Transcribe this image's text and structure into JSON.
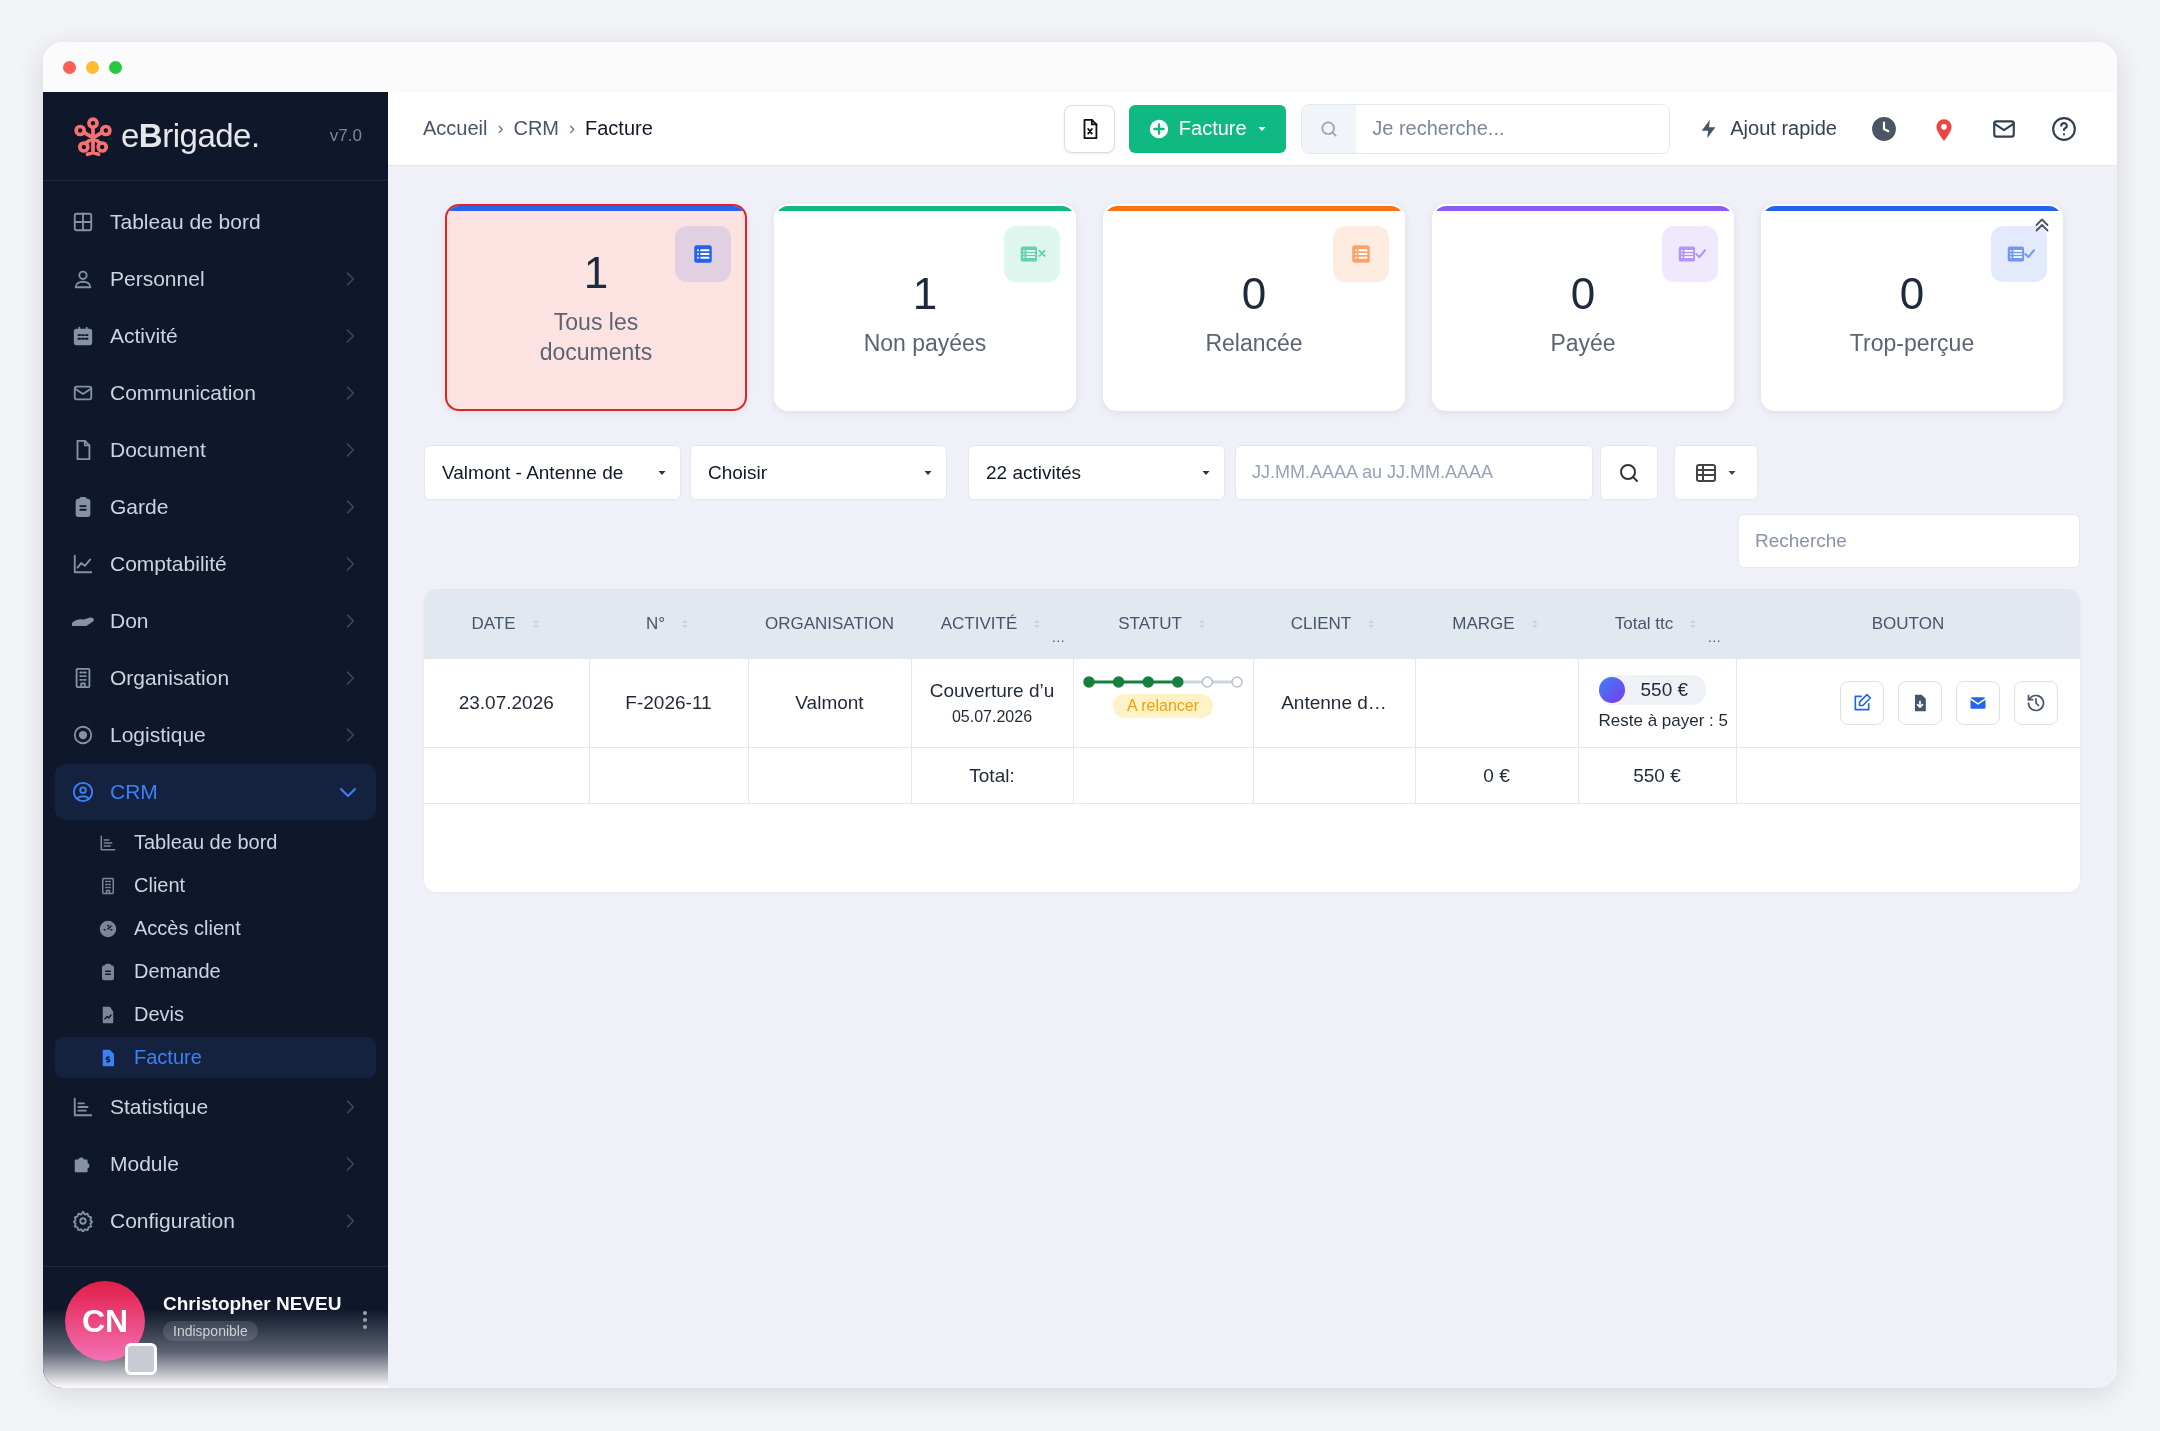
{
  "sidebar": {
    "logo": "e**B**rigade.",
    "version": "v7.0",
    "items": [
      {
        "label": "Tableau de bord",
        "kind": "link",
        "selected": false
      },
      {
        "label": "Personnel",
        "kind": "group",
        "expanded": false,
        "selected": false
      },
      {
        "label": "Activité",
        "kind": "group",
        "expanded": false,
        "selected": false
      },
      {
        "label": "Communication",
        "kind": "group",
        "expanded": false,
        "selected": false
      },
      {
        "label": "Document",
        "kind": "group",
        "expanded": false,
        "selected": false
      },
      {
        "label": "Garde",
        "kind": "group",
        "expanded": false,
        "selected": false
      },
      {
        "label": "Comptabilité",
        "kind": "group",
        "expanded": false,
        "selected": false
      },
      {
        "label": "Don",
        "kind": "group",
        "expanded": false,
        "selected": false
      },
      {
        "label": "Organisation",
        "kind": "group",
        "expanded": false,
        "selected": false
      },
      {
        "label": "Logistique",
        "kind": "group",
        "expanded": false,
        "selected": false
      },
      {
        "label": "CRM",
        "kind": "group",
        "expanded": true,
        "selected": true,
        "children": [
          {
            "label": "Tableau de bord",
            "selected": false
          },
          {
            "label": "Client",
            "selected": false
          },
          {
            "label": "Accès client",
            "selected": false
          },
          {
            "label": "Demande",
            "selected": false
          },
          {
            "label": "Devis",
            "selected": false
          },
          {
            "label": "Facture",
            "selected": true
          }
        ]
      },
      {
        "label": "Statistique",
        "kind": "group",
        "expanded": false,
        "selected": false
      },
      {
        "label": "Module",
        "kind": "group",
        "expanded": false,
        "selected": false
      },
      {
        "label": "Configuration",
        "kind": "group",
        "expanded": false,
        "selected": false
      }
    ],
    "user": {
      "initials": "CN",
      "name": "Christopher NEVEU",
      "status": "Indisponible"
    }
  },
  "topbar": {
    "breadcrumbs": [
      "Accueil",
      "CRM",
      "Facture"
    ],
    "separator": "›",
    "new_button": "Facture",
    "search": {
      "placeholder": "Je recherche..."
    },
    "quick_add": "Ajout rapide"
  },
  "cards": [
    {
      "count": "1",
      "label": "Tous les documents",
      "color": "#2563eb",
      "selected": true,
      "kind": "list"
    },
    {
      "count": "1",
      "label": "Non payées",
      "color": "#10b981",
      "selected": false,
      "kind": "list-x"
    },
    {
      "count": "0",
      "label": "Relancée",
      "color": "#f97316",
      "selected": false,
      "kind": "list"
    },
    {
      "count": "0",
      "label": "Payée",
      "color": "#8b5cf6",
      "selected": false,
      "kind": "list-check"
    },
    {
      "count": "0",
      "label": "Trop-perçue",
      "color": "#2563eb",
      "selected": false,
      "kind": "list-check"
    }
  ],
  "filters": {
    "organisation": "Valmont - Antenne de",
    "type": "Choisir",
    "activities": "22 activités",
    "date": {
      "placeholder": "JJ.MM.AAAA au JJ.MM.AAAA"
    },
    "search": {
      "placeholder": "Recherche"
    }
  },
  "table": {
    "columns": [
      {
        "label": "DATE",
        "sortable": true
      },
      {
        "label": "N°",
        "sortable": true
      },
      {
        "label": "ORGANISATION",
        "sortable": false
      },
      {
        "label": "ACTIVITÉ",
        "sortable": true,
        "more": "…"
      },
      {
        "label": "STATUT",
        "sortable": true
      },
      {
        "label": "CLIENT",
        "sortable": true
      },
      {
        "label": "MARGE",
        "sortable": true
      },
      {
        "label": "Total ttc",
        "sortable": true,
        "more": "…"
      },
      {
        "label": "BOUTON",
        "sortable": false
      }
    ],
    "rows": [
      {
        "date": "23.07.2026",
        "number": "F-2026-11",
        "organisation": "Valmont",
        "activity": {
          "title": "Couverture d’u",
          "date": "05.07.2026"
        },
        "status": {
          "steps": [
            {
              "done": true
            },
            {
              "done": true
            },
            {
              "done": true
            },
            {
              "done": true
            },
            {
              "done": false
            },
            {
              "done": false
            }
          ],
          "badge": "A relancer"
        },
        "client": "Antenne d…",
        "total": {
          "amount": "550 €",
          "remaining": "Reste à payer : 5"
        }
      }
    ],
    "totals": {
      "label": "Total:",
      "marge": "0 €",
      "total": "550 €"
    }
  }
}
